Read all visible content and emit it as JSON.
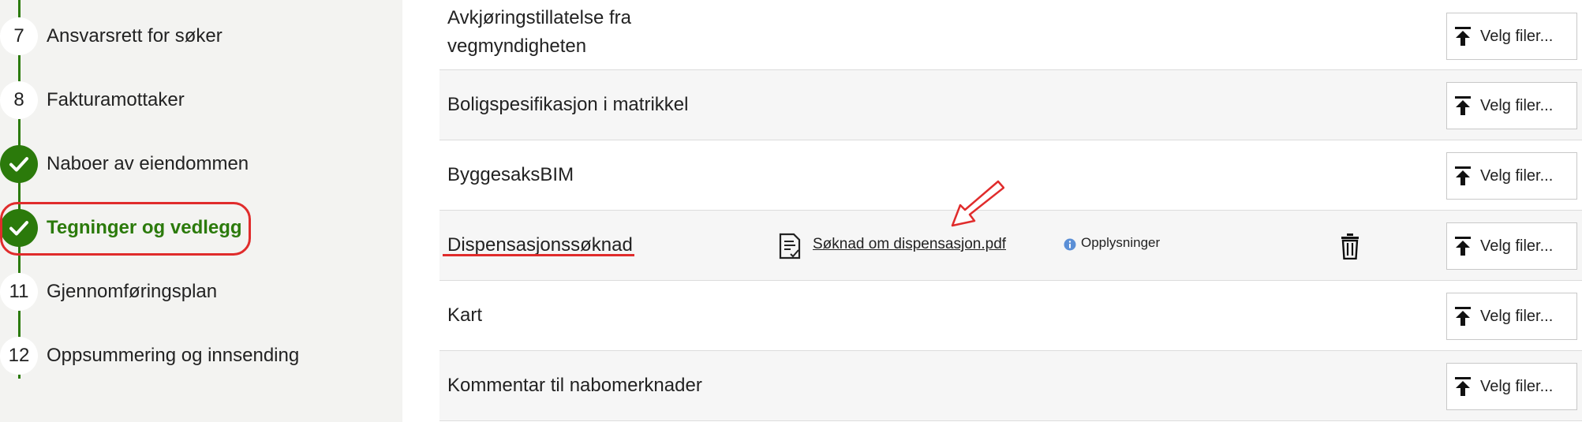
{
  "sidebar": {
    "steps": [
      {
        "number": "7",
        "label": "Ansvarsrett for søker",
        "status": "pending"
      },
      {
        "number": "8",
        "label": "Fakturamottaker",
        "status": "pending"
      },
      {
        "number": "",
        "label": "Naboer av eiendommen",
        "status": "done"
      },
      {
        "number": "",
        "label": "Tegninger og vedlegg",
        "status": "done-active"
      },
      {
        "number": "11",
        "label": "Gjennomføringsplan",
        "status": "pending"
      },
      {
        "number": "12",
        "label": "Oppsummering og innsending",
        "status": "pending"
      }
    ]
  },
  "attachments": {
    "upload_label": "Velg filer...",
    "rows": [
      {
        "title_line1": "Avkjøringstillatelse fra",
        "title_line2": "vegmyndigheten"
      },
      {
        "title": "Boligspesifikasjon i matrikkel"
      },
      {
        "title": "ByggesaksBIM"
      },
      {
        "title": "Dispensasjonssøknad",
        "file_name": "Søknad om dispensasjon.pdf",
        "info_label": "Opplysninger"
      },
      {
        "title": "Kart"
      },
      {
        "title": "Kommentar til nabomerknader"
      }
    ]
  },
  "colors": {
    "green": "#2b7a0b",
    "highlight_red": "#e02c2c",
    "info_blue": "#5b8fd6"
  },
  "icons": [
    "checkmark-icon",
    "upload-icon",
    "file-icon",
    "info-icon",
    "trash-icon",
    "arrow-annotation"
  ]
}
